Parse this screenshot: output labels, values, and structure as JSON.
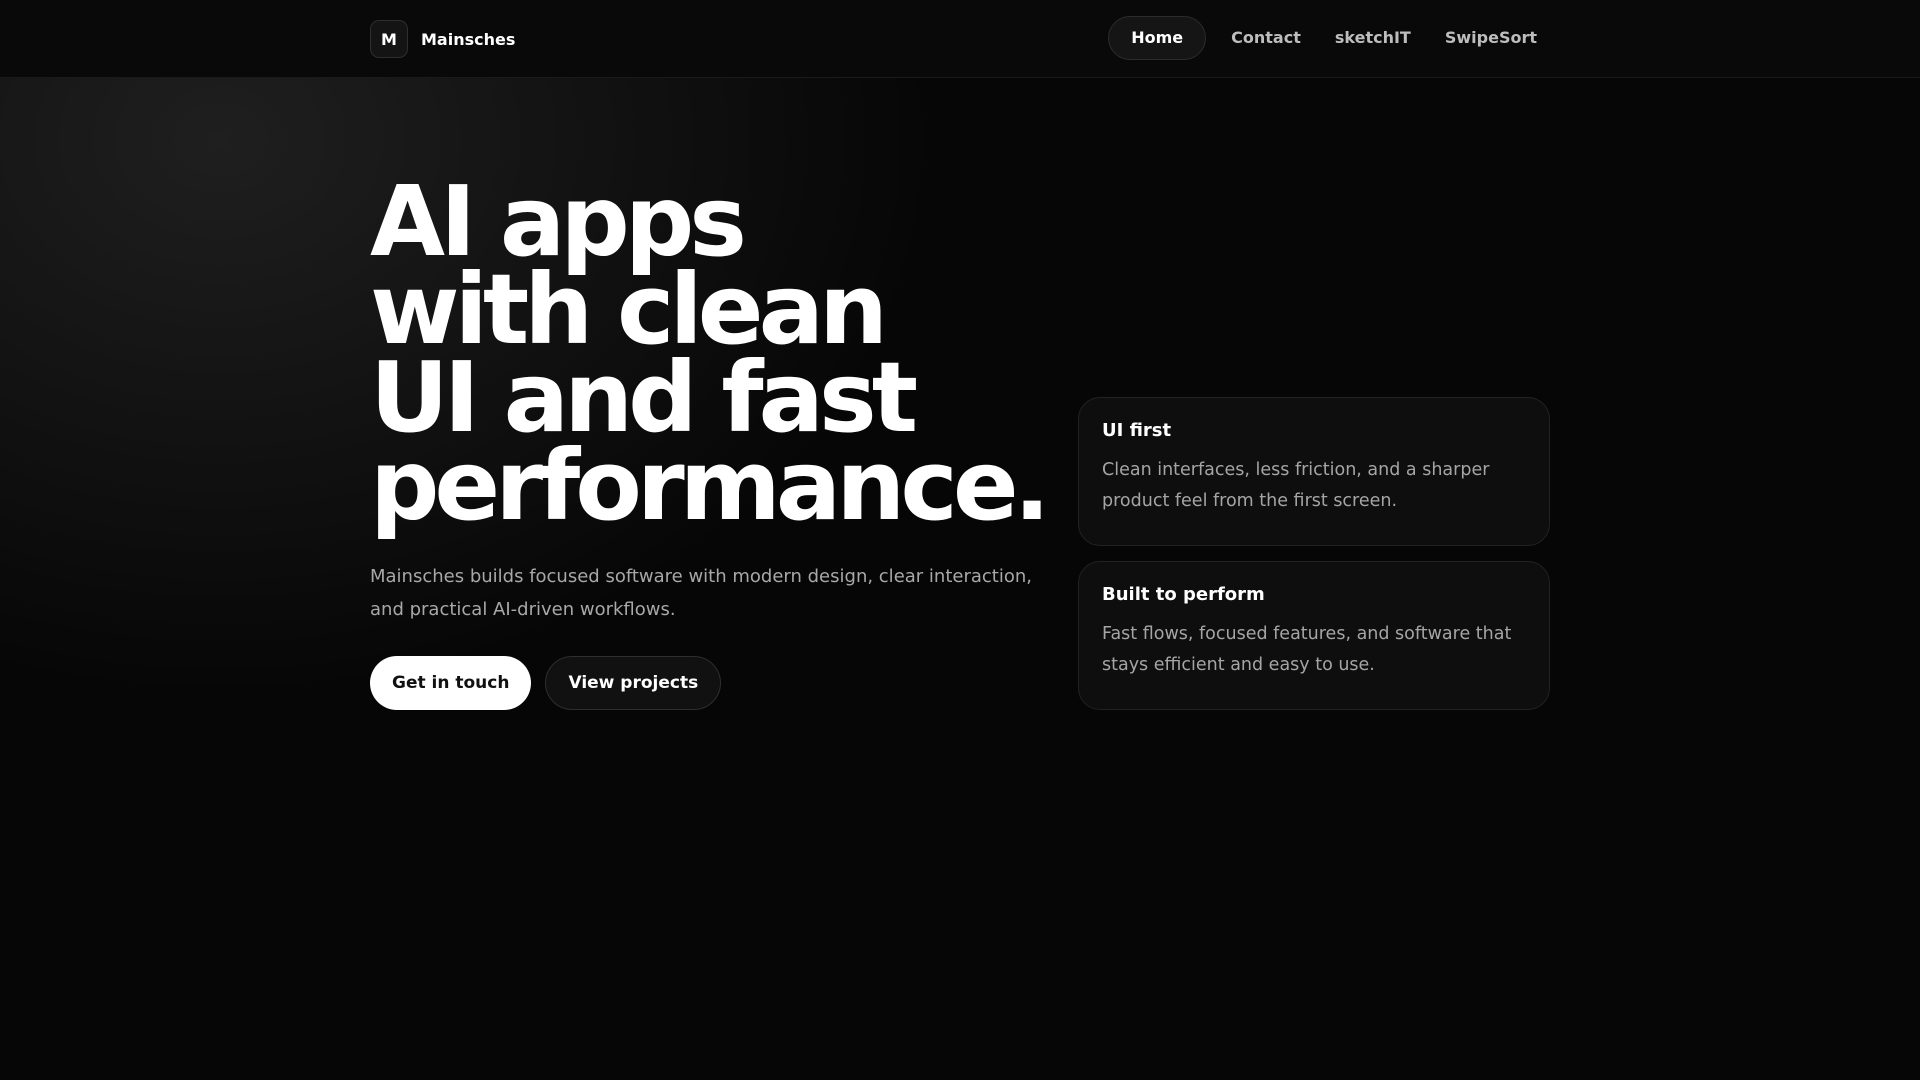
{
  "header": {
    "logo_letter": "M",
    "brand": "Mainsches",
    "nav": [
      {
        "label": "Home",
        "active": true
      },
      {
        "label": "Contact"
      },
      {
        "label": "sketchIT"
      },
      {
        "label": "SwipeSort"
      }
    ]
  },
  "hero": {
    "title_lines": [
      "AI apps",
      "with clean",
      "UI and fast",
      "performance."
    ],
    "subtitle": "Mainsches builds focused software with modern design, clear interaction, and practical AI-driven workflows.",
    "primary_button": "Get in touch",
    "secondary_button": "View projects"
  },
  "cards": [
    {
      "title": "UI first",
      "body": "Clean interfaces, less friction, and a sharper product feel from the first screen."
    },
    {
      "title": "Built to perform",
      "body": "Fast flows, focused features, and software that stays efficient and easy to use."
    }
  ]
}
